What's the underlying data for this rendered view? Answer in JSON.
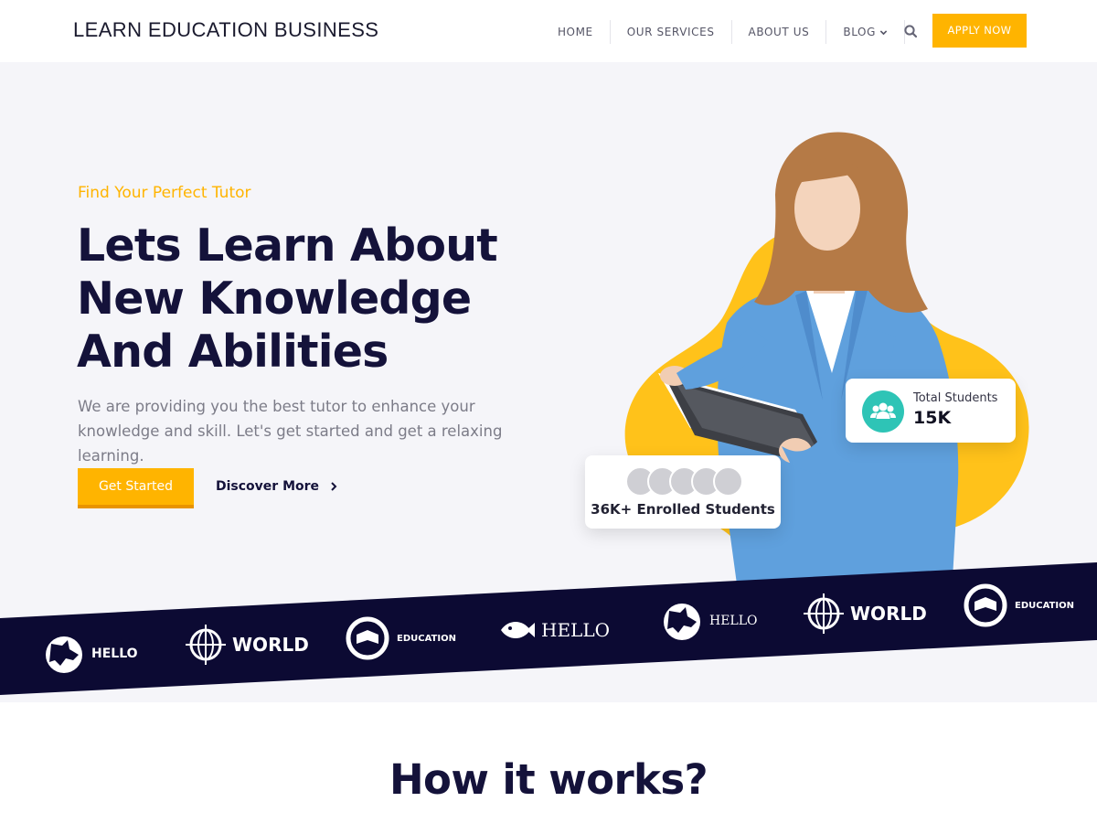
{
  "header": {
    "brand": "LEARN EDUCATION BUSINESS",
    "nav": [
      "HOME",
      "OUR SERVICES",
      "ABOUT US",
      "BLOG"
    ],
    "apply": "APPLY NOW"
  },
  "hero": {
    "tagline": "Find Your Perfect Tutor",
    "title": "Lets Learn About New Knowledge And Abilities",
    "description": "We are providing you the best tutor to enhance your knowledge and skill. Let's get started and get a relaxing learning.",
    "primary_button": "Get Started",
    "secondary_link": "Discover More",
    "students_card": {
      "label": "Total Students",
      "value": "15K"
    },
    "enrolled_card": {
      "value": "36K+ Enrolled Students"
    }
  },
  "logos": [
    "HELLO",
    "WORLD",
    "EDUCATION",
    "HELLO",
    "HELLO",
    "WORLD",
    "EDUCATION"
  ],
  "section": {
    "title": "How it works?"
  },
  "colors": {
    "accent": "#ffb400",
    "navy": "#0c0a33",
    "teal": "#2ec4b6",
    "hero_bg": "#f5f5f9"
  }
}
